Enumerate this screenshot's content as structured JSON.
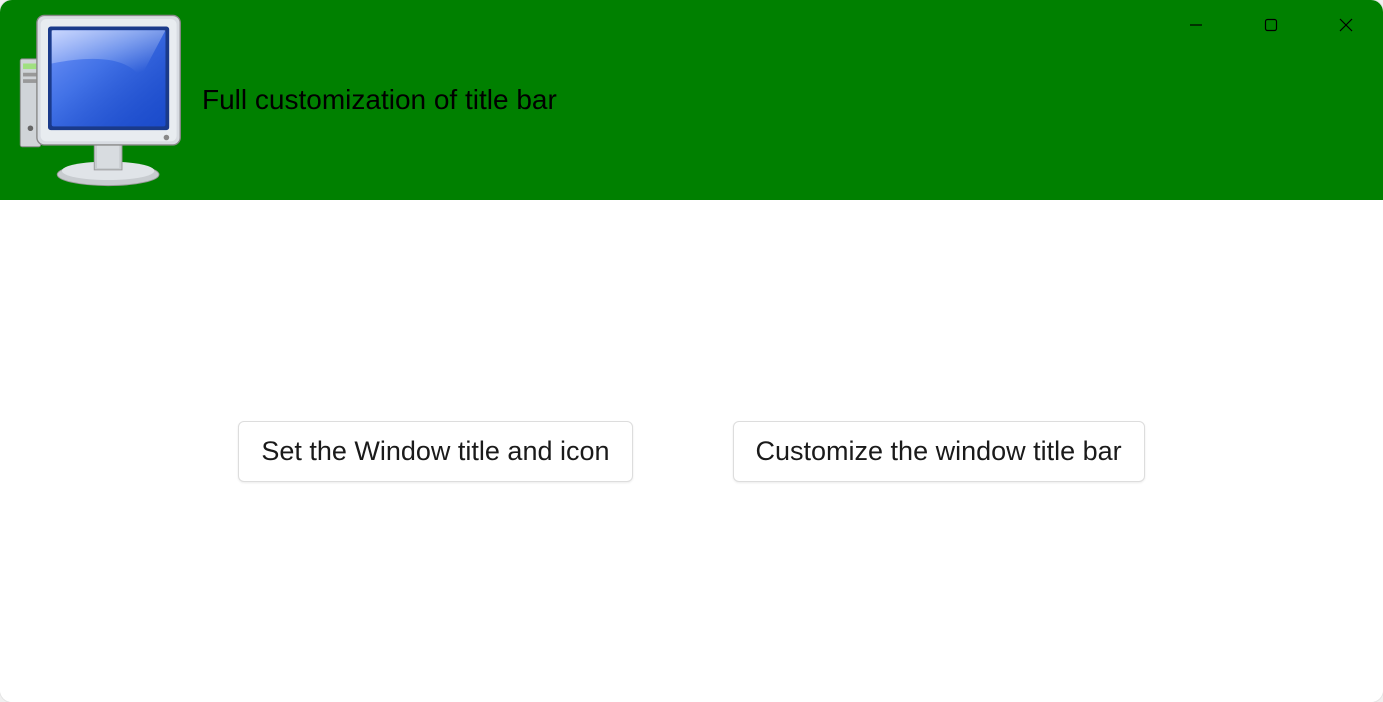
{
  "titlebar": {
    "title": "Full customization of title bar",
    "icon_name": "computer-monitor-icon",
    "background_color": "#008000"
  },
  "window_controls": {
    "minimize": "minimize",
    "maximize": "maximize",
    "close": "close"
  },
  "content": {
    "buttons": [
      {
        "label": "Set the Window title and icon"
      },
      {
        "label": "Customize the window title bar"
      }
    ]
  }
}
